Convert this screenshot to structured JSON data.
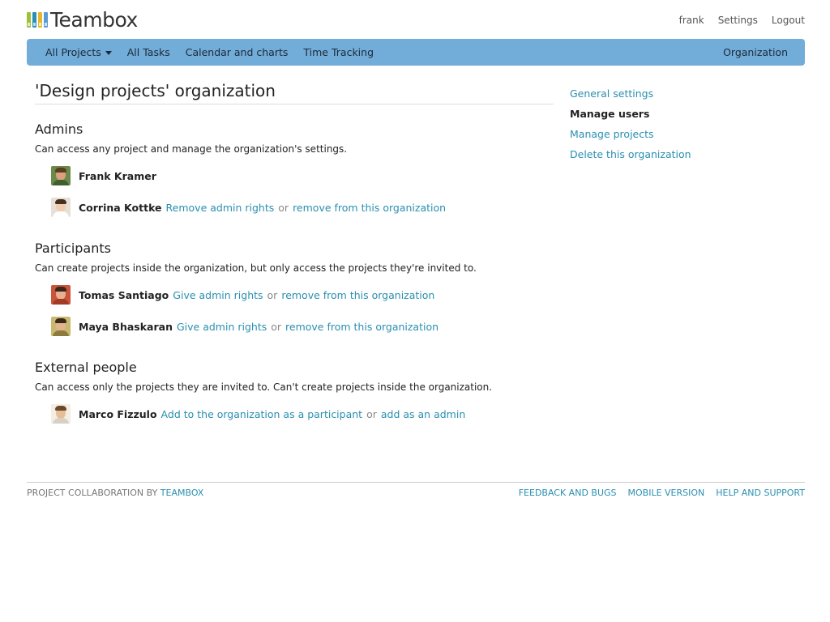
{
  "header": {
    "app_name": "Teambox",
    "logo_colors": [
      "#9bc23c",
      "#2a8fb0",
      "#e2b830",
      "#5a9bd5"
    ],
    "links": {
      "user": "frank",
      "settings": "Settings",
      "logout": "Logout"
    }
  },
  "nav": {
    "items": [
      "All Projects",
      "All Tasks",
      "Calendar and charts",
      "Time Tracking"
    ],
    "right": "Organization",
    "bar_color": "#72acd9"
  },
  "main": {
    "title": "'Design projects' organization",
    "sections": [
      {
        "heading": "Admins",
        "description": "Can access any project and manage the organization's settings.",
        "users": [
          {
            "name": "Frank Kramer",
            "actions": []
          },
          {
            "name": "Corrina Kottke",
            "actions": [
              "Remove admin rights",
              "remove from this organization"
            ]
          }
        ]
      },
      {
        "heading": "Participants",
        "description": "Can create projects inside the organization, but only access the projects they're invited to.",
        "users": [
          {
            "name": "Tomas Santiago",
            "actions": [
              "Give admin rights",
              "remove from this organization"
            ]
          },
          {
            "name": "Maya Bhaskaran",
            "actions": [
              "Give admin rights",
              "remove from this organization"
            ]
          }
        ]
      },
      {
        "heading": "External people",
        "description": "Can access only the projects they are invited to. Can't create projects inside the organization.",
        "users": [
          {
            "name": "Marco Fizzulo",
            "actions": [
              "Add to the organization as a participant",
              "add as an admin"
            ]
          }
        ]
      }
    ],
    "separator_word": "or"
  },
  "sidebar": {
    "items": [
      {
        "label": "General settings"
      },
      {
        "label": "Manage users"
      },
      {
        "label": "Manage projects"
      },
      {
        "label": "Delete this organization"
      }
    ]
  },
  "footer": {
    "left_prefix": "PROJECT COLLABORATION BY",
    "left_link": "TEAMBOX",
    "links": [
      "FEEDBACK AND BUGS",
      "MOBILE VERSION",
      "HELP AND SUPPORT"
    ]
  },
  "colors": {
    "link": "#2a8fb0",
    "text": "#222222"
  }
}
